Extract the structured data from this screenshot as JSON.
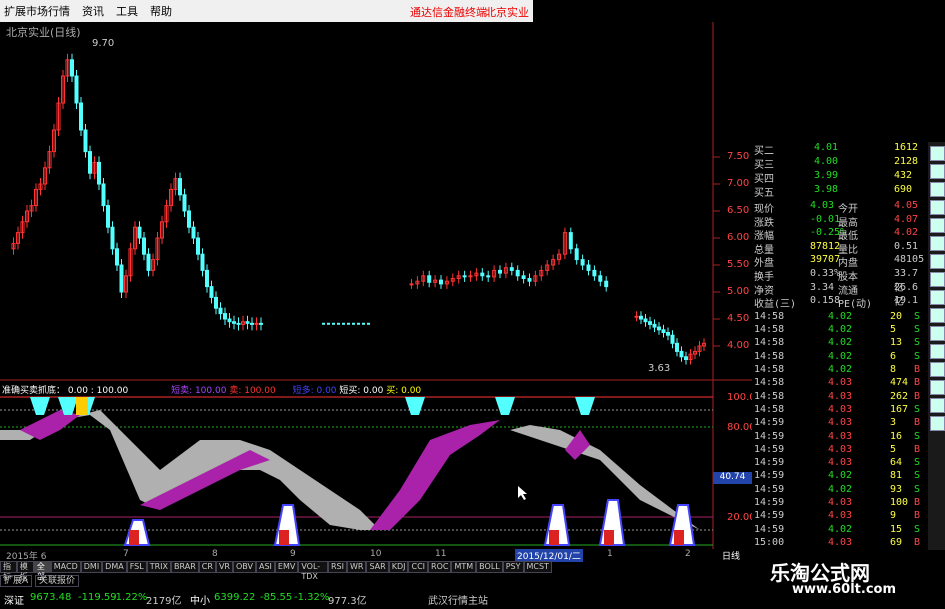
{
  "menu": {
    "items": [
      "扩展市场行情",
      "资讯",
      "工具",
      "帮助"
    ],
    "right1": "通达信金融终端",
    "right2": "北京实业"
  },
  "chart_title": "北京实业(日线)",
  "high_label": "9.70",
  "low_label": "3.63",
  "price_axis": [
    "7.50",
    "7.00",
    "6.50",
    "6.00",
    "5.50",
    "5.00",
    "4.50",
    "4.00"
  ],
  "indicator_axis": [
    "100.0",
    "80.00",
    "40.74",
    "20.00"
  ],
  "indicator_header": {
    "name": "准确买卖抓底：",
    "v1": "0.00 : 100.00",
    "s1": "短卖: 100.00",
    "s2": "卖: 100.00",
    "s3": "短多: 0.00",
    "s4": "短买: 0.00",
    "s5": "买: 0.00"
  },
  "cursor_value": "40.74",
  "date_axis": [
    "2015年 6",
    "7",
    "8",
    "9",
    "10",
    "11",
    "2015/12/01/二",
    "1",
    "2"
  ],
  "date_right": "日线",
  "quote": {
    "bids": [
      {
        "label": "买二",
        "price": "4.01",
        "vol": "1612"
      },
      {
        "label": "买三",
        "price": "4.00",
        "vol": "2128"
      },
      {
        "label": "买四",
        "price": "3.99",
        "vol": "432"
      },
      {
        "label": "买五",
        "price": "3.98",
        "vol": "690"
      }
    ],
    "stats": [
      {
        "k1": "现价",
        "v1": "4.03",
        "k2": "今开",
        "v2": "4.05"
      },
      {
        "k1": "涨跌",
        "v1": "-0.01",
        "k2": "最高",
        "v2": "4.07"
      },
      {
        "k1": "涨幅",
        "v1": "-0.25%",
        "k2": "最低",
        "v2": "4.02"
      },
      {
        "k1": "总量",
        "v1": "87812",
        "k2": "量比",
        "v2": "0.51"
      },
      {
        "k1": "外盘",
        "v1": "39707",
        "k2": "内盘",
        "v2": "48105"
      },
      {
        "k1": "换手",
        "v1": "0.33%",
        "k2": "股本",
        "v2": "33.7亿"
      },
      {
        "k1": "净资",
        "v1": "3.34",
        "k2": "流通",
        "v2": "26.6亿"
      },
      {
        "k1": "收益(三)",
        "v1": "0.158",
        "k2": "PE(动)",
        "v2": "19.1"
      }
    ],
    "ticks": [
      {
        "t": "14:58",
        "p": "4.02",
        "v": "20",
        "s": "S"
      },
      {
        "t": "14:58",
        "p": "4.02",
        "v": "5",
        "s": "S"
      },
      {
        "t": "14:58",
        "p": "4.02",
        "v": "13",
        "s": "S"
      },
      {
        "t": "14:58",
        "p": "4.02",
        "v": "6",
        "s": "S"
      },
      {
        "t": "14:58",
        "p": "4.02",
        "v": "8",
        "s": "B"
      },
      {
        "t": "14:58",
        "p": "4.03",
        "v": "474",
        "s": "B"
      },
      {
        "t": "14:58",
        "p": "4.03",
        "v": "262",
        "s": "B"
      },
      {
        "t": "14:58",
        "p": "4.03",
        "v": "167",
        "s": "S"
      },
      {
        "t": "14:59",
        "p": "4.03",
        "v": "3",
        "s": "B"
      },
      {
        "t": "14:59",
        "p": "4.03",
        "v": "16",
        "s": "S"
      },
      {
        "t": "14:59",
        "p": "4.03",
        "v": "5",
        "s": "B"
      },
      {
        "t": "14:59",
        "p": "4.03",
        "v": "64",
        "s": "S"
      },
      {
        "t": "14:59",
        "p": "4.02",
        "v": "81",
        "s": "S"
      },
      {
        "t": "14:59",
        "p": "4.02",
        "v": "93",
        "s": "S"
      },
      {
        "t": "14:59",
        "p": "4.03",
        "v": "100",
        "s": "B"
      },
      {
        "t": "14:59",
        "p": "4.03",
        "v": "9",
        "s": "B"
      },
      {
        "t": "14:59",
        "p": "4.02",
        "v": "15",
        "s": "S"
      },
      {
        "t": "15:00",
        "p": "4.03",
        "v": "69",
        "s": "B"
      }
    ]
  },
  "tabs": [
    "指标",
    "模板",
    "全部",
    "MACD",
    "DMI",
    "DMA",
    "FSL",
    "TRIX",
    "BRAR",
    "CR",
    "VR",
    "OBV",
    "ASI",
    "EMV",
    "VOL-TDX",
    "RSI",
    "WR",
    "SAR",
    "KDJ",
    "CCI",
    "ROC",
    "MTM",
    "BOLL",
    "PSY",
    "MCST"
  ],
  "active_tab": "全部",
  "sub_tabs": [
    "扩展A",
    "关联报价"
  ],
  "status": {
    "s1_name": "深证",
    "s1_val": "9673.48",
    "s1_chg": "-119.59",
    "s1_pct": "-1.22%",
    "s1_amt": "2179亿",
    "s2_name": "中小",
    "s2_val": "6399.22",
    "s2_chg": "-85.55",
    "s2_pct": "-1.32%",
    "s2_amt": "977.3亿",
    "station": "武汉行情主站"
  },
  "watermark": {
    "name": "乐淘公式网",
    "url": "www.60lt.com"
  },
  "colors": {
    "up": "#ff3333",
    "down": "#54ffff",
    "magenta": "#aa22aa",
    "gray": "#b0b0b0",
    "green": "#22dd22",
    "blue": "#4444ff"
  }
}
